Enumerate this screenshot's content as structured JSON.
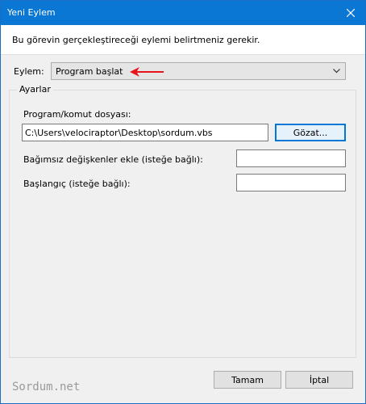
{
  "window": {
    "title": "Yeni Eylem"
  },
  "instruction": "Bu görevin gerçekleştireceği eylemi belirtmeniz gerekir.",
  "action": {
    "label": "Eylem:",
    "value": "Program başlat"
  },
  "settings": {
    "legend": "Ayarlar",
    "program": {
      "label": "Program/komut dosyası:",
      "value": "C:\\Users\\velociraptor\\Desktop\\sordum.vbs",
      "browse_label": "Gözat..."
    },
    "arguments": {
      "label": "Bağımsız değişkenler ekle (isteğe bağlı):",
      "value": ""
    },
    "start_in": {
      "label": "Başlangıç (isteğe bağlı):",
      "value": ""
    }
  },
  "buttons": {
    "ok": "Tamam",
    "cancel": "İptal"
  },
  "watermark": "Sordum.net",
  "colors": {
    "titlebar": "#0a77d4",
    "accent": "#0078d7",
    "arrow": "#e8141b"
  }
}
